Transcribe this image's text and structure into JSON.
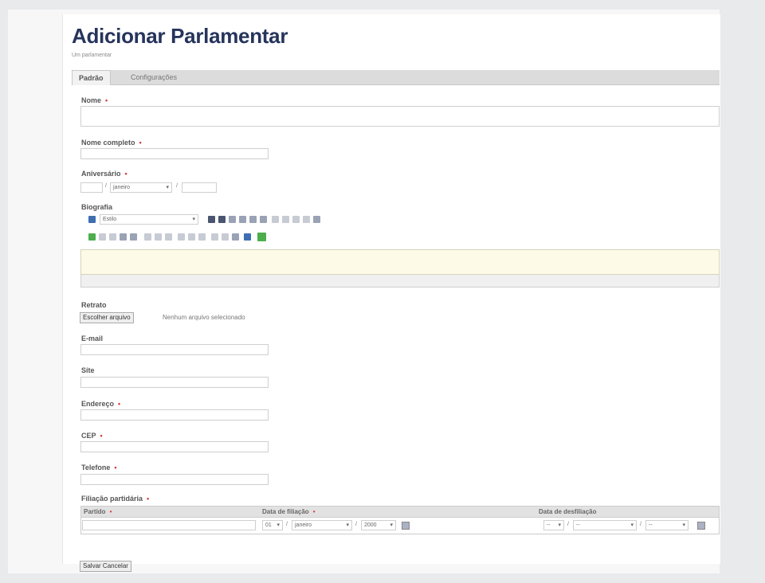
{
  "page": {
    "title": "Adicionar Parlamentar",
    "subtitle": "Um parlamentar"
  },
  "tabs": [
    {
      "label": "Padrão",
      "active": true
    },
    {
      "label": "Configurações",
      "active": false
    }
  ],
  "form": {
    "nome": {
      "label": "Nome",
      "value": ""
    },
    "nome_completo": {
      "label": "Nome completo",
      "value": ""
    },
    "aniversario": {
      "label": "Aniversário",
      "day": "",
      "month": "janeiro",
      "year": ""
    },
    "biografia": {
      "label": "Biografia",
      "style_select": "Estilo"
    },
    "retrato": {
      "label": "Retrato",
      "button": "Escolher arquivo",
      "status": "Nenhum arquivo selecionado"
    },
    "email": {
      "label": "E-mail",
      "value": ""
    },
    "site": {
      "label": "Site",
      "value": ""
    },
    "endereco": {
      "label": "Endereço",
      "value": ""
    },
    "cep": {
      "label": "CEP",
      "value": ""
    },
    "telefone": {
      "label": "Telefone",
      "value": ""
    },
    "filiacao": {
      "label": "Filiação partidária",
      "columns": [
        "Partido",
        "Data de filiação",
        "Data de desfiliação"
      ],
      "row": {
        "filiacao_day": "01",
        "filiacao_month": "janeiro",
        "filiacao_year": "2000",
        "desfiliacao_day": "--",
        "desfiliacao_month": "--",
        "desfiliacao_year": "--"
      }
    }
  },
  "actions": {
    "save": "Salvar",
    "cancel": "Cancelar"
  },
  "required_mark": "•",
  "colors": {
    "title": "#26345c",
    "required": "#d13b3b",
    "editor_bg": "#fdfbe7"
  }
}
